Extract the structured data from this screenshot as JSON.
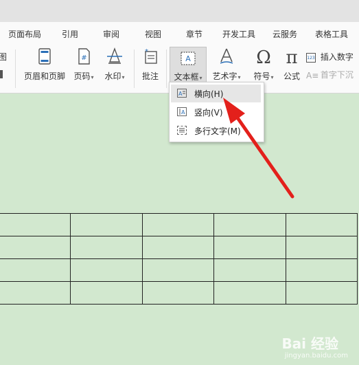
{
  "menu": {
    "items": [
      "页面布局",
      "引用",
      "审阅",
      "视图",
      "章节",
      "开发工具",
      "云服务",
      "表格工具"
    ]
  },
  "ribbon": {
    "partial_left_top": "图",
    "header_footer": "页眉和页脚",
    "page_number": "页码",
    "watermark": "水印",
    "comment": "批注",
    "textbox": "文本框",
    "wordart": "艺术字",
    "symbol": "符号",
    "formula": "公式",
    "insert_number": "插入数字",
    "drop_cap": "首字下沉"
  },
  "dropdown": {
    "items": [
      {
        "label": "横向(H)",
        "icon": "horizontal-textbox-icon"
      },
      {
        "label": "竖向(V)",
        "icon": "vertical-textbox-icon"
      },
      {
        "label": "多行文字(M)",
        "icon": "multiline-text-icon"
      }
    ]
  },
  "watermark": {
    "brand": "Bai 经验",
    "url": "jingyan.baidu.com"
  },
  "colors": {
    "document_bg": "#d2e8cf",
    "arrow": "#e3201b"
  }
}
